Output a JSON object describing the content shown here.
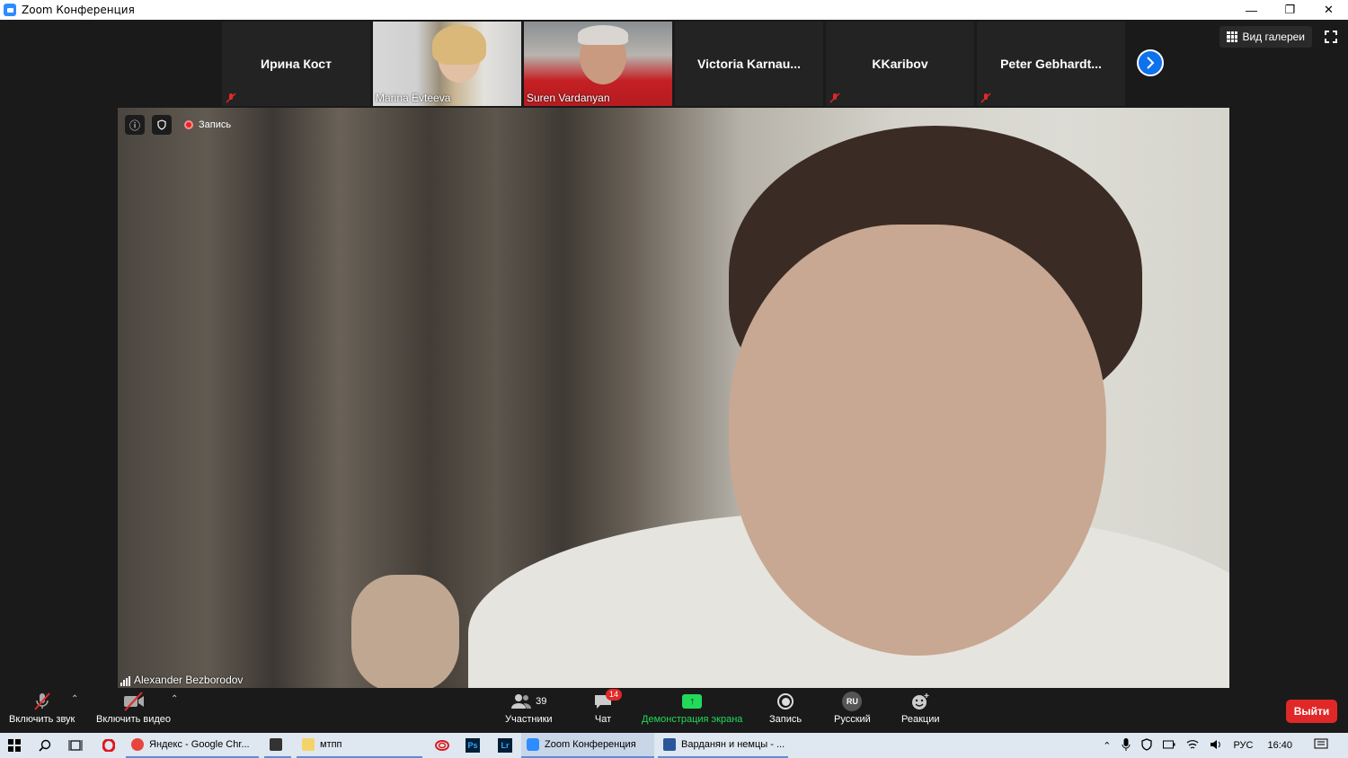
{
  "window": {
    "title": "Zoom Конференция",
    "minimize": "—",
    "restore": "❐",
    "close": "✕"
  },
  "thumbnails": [
    {
      "name": "Ирина Кост",
      "type": "avatar",
      "muted": true
    },
    {
      "name": "Marina Evteeva",
      "type": "video",
      "muted": false
    },
    {
      "name": "Suren Vardanyan",
      "type": "video",
      "muted": false
    },
    {
      "name": "Victoria  Karnau...",
      "type": "avatar",
      "muted": false
    },
    {
      "name": "KKaribov",
      "type": "avatar",
      "muted": true
    },
    {
      "name": "Peter  Gebhardt...",
      "type": "avatar",
      "muted": true
    }
  ],
  "gallery_view_label": "Вид галереи",
  "speaker": {
    "name": "Alexander Bezborodov",
    "recording_label": "Запись"
  },
  "toolbar": {
    "unmute_label": "Включить звук",
    "start_video_label": "Включить видео",
    "participants_label": "Участники",
    "participants_count": "39",
    "chat_label": "Чат",
    "chat_badge": "14",
    "share_label": "Демонстрация экрана",
    "record_label": "Запись",
    "language_label": "Русский",
    "language_code": "RU",
    "reactions_label": "Реакции",
    "leave_label": "Выйти"
  },
  "taskbar": {
    "apps": [
      {
        "label": "Яндекс - Google Chr...",
        "color": "#e8453c"
      },
      {
        "label": "",
        "color": "#333333"
      },
      {
        "label": "мтпп",
        "color": "#f5d36b"
      },
      {
        "label": "",
        "color": "#d81e1e"
      },
      {
        "label": "Ps",
        "color": "#001e36"
      },
      {
        "label": "Lr",
        "color": "#001e36"
      },
      {
        "label": "Zoom Конференция",
        "color": "#2d8cff"
      },
      {
        "label": "Варданян и немцы - ...",
        "color": "#2b579a"
      }
    ],
    "lang": "РУС",
    "time": "16:40"
  },
  "colors": {
    "accent": "#2d8cff",
    "share_green": "#23d959",
    "leave_red": "#e02828"
  }
}
